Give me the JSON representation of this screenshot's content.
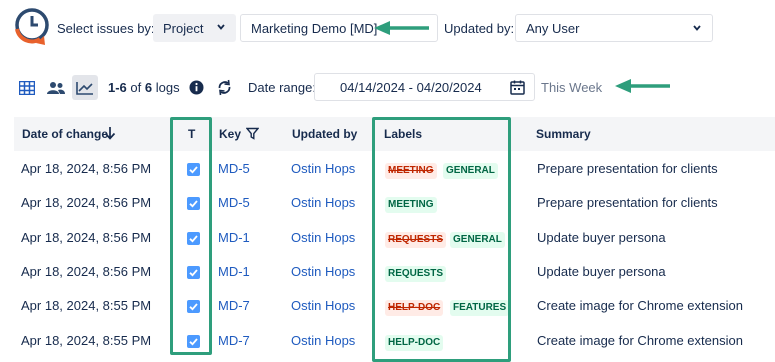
{
  "filters": {
    "select_by_label": "Select issues by:",
    "type_select": "Project",
    "project_select": "Marketing Demo [MD]",
    "updated_by_label": "Updated by:",
    "user_select": "Any User"
  },
  "toolbar": {
    "count_range": "1-6",
    "count_of": "of",
    "count_total": "6",
    "count_suffix": "logs",
    "date_range_label": "Date range:",
    "date_range_value": "04/14/2024 - 04/20/2024",
    "preset": "This Week"
  },
  "table": {
    "columns": {
      "date": "Date of change",
      "type": "T",
      "key": "Key",
      "updated_by": "Updated by",
      "labels": "Labels",
      "summary": "Summary"
    },
    "rows": [
      {
        "date": "Apr 18, 2024, 8:56 PM",
        "key": "MD-5",
        "user": "Ostin Hops",
        "removed": "MEETING",
        "added": "GENERAL",
        "summary": "Prepare presentation for clients"
      },
      {
        "date": "Apr 18, 2024, 8:56 PM",
        "key": "MD-5",
        "user": "Ostin Hops",
        "removed": "",
        "added": "MEETING",
        "summary": "Prepare presentation for clients"
      },
      {
        "date": "Apr 18, 2024, 8:56 PM",
        "key": "MD-1",
        "user": "Ostin Hops",
        "removed": "REQUESTS",
        "added": "GENERAL",
        "summary": "Update buyer persona"
      },
      {
        "date": "Apr 18, 2024, 8:56 PM",
        "key": "MD-1",
        "user": "Ostin Hops",
        "removed": "",
        "added": "REQUESTS",
        "summary": "Update buyer persona"
      },
      {
        "date": "Apr 18, 2024, 8:55 PM",
        "key": "MD-7",
        "user": "Ostin Hops",
        "removed": "HELP-DOC",
        "added": "FEATURES",
        "summary": "Create image for Chrome extension"
      },
      {
        "date": "Apr 18, 2024, 8:55 PM",
        "key": "MD-7",
        "user": "Ostin Hops",
        "removed": "",
        "added": "HELP-DOC",
        "summary": "Create image for Chrome extension"
      }
    ]
  },
  "colors": {
    "highlight": "#2e9e7c",
    "link": "#1f5bbf",
    "checkbox": "#4c9aff",
    "removed_bg": "#ffebe6",
    "added_bg": "#e3fcef"
  },
  "icons": [
    "history-logo-icon",
    "chevron-down-icon",
    "grid-view-icon",
    "users-icon",
    "chart-icon",
    "info-icon",
    "refresh-icon",
    "calendar-icon",
    "sort-down-icon",
    "filter-icon",
    "checkbox-icon"
  ]
}
